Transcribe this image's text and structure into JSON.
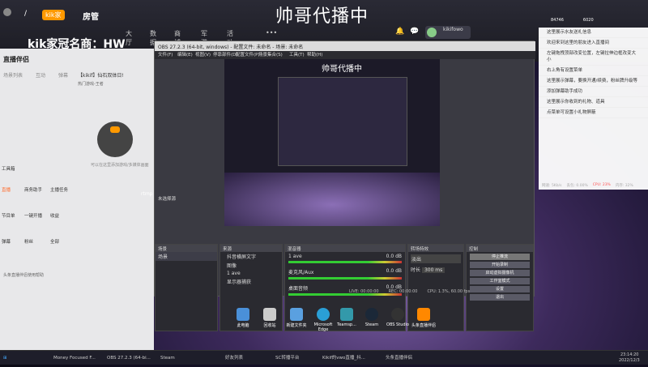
{
  "stream": {
    "title": "帅哥代播中",
    "nick_prefix": "/",
    "badge": "kik家",
    "manager": "房管",
    "overlay_name": "kik家冠名商：HW",
    "user": "kikifowo",
    "level": "4/5"
  },
  "topnav": {
    "items": [
      "大厅",
      "数据",
      "商城",
      "军港",
      "活动中心",
      "•••"
    ]
  },
  "left": {
    "brand": "直播伴侣",
    "tabs": [
      "场景列表",
      "互动",
      "弹幕"
    ],
    "date_label": "【kikif】仙石双体日!",
    "scene_label": "热门游戏-王者",
    "hint": "可以在这里添加游戏/多媒体画面",
    "tools": [
      "工具箱",
      "直播",
      "商务助手",
      "主播任务",
      "节目单",
      "一键开播",
      "收益",
      "弹幕",
      "粉丝",
      "全部",
      "更多"
    ],
    "status": "头条直播伴侣使用帮助",
    "rtmp": "rtmp"
  },
  "obs": {
    "title": "OBS 27.2.3 (64-bit, windows) - 配置文件: 未命名 - 场景: 未命名",
    "menu": [
      "文件(F)",
      "编辑(E)",
      "视图(V)",
      "停靠部件(D)",
      "配置文件(P)",
      "场景集合(S)",
      "工具(T)",
      "帮助(H)"
    ],
    "docks": {
      "scenes": "场景",
      "sources": "来源",
      "mixer": "混音器",
      "transitions": "转场特效",
      "controls": "控制"
    },
    "scene_items": [
      "场景"
    ],
    "source_items": [
      "抖音横屏文字",
      "图像",
      "1 ave",
      "显示器捕获"
    ],
    "mixer": [
      {
        "name": "1 ave",
        "db": "0.0 dB"
      },
      {
        "name": "麦克风/Aux",
        "db": "0.0 dB"
      },
      {
        "name": "桌面音频",
        "db": "0.0 dB"
      }
    ],
    "trans": {
      "type": "淡出",
      "dur_label": "时长",
      "dur": "300 ms"
    },
    "controls": [
      "停止推流",
      "开始录制",
      "启动虚拟摄像机",
      "工作室模式",
      "设置",
      "退出"
    ],
    "status": {
      "live": "LIVE: 00:00:00",
      "rec": "REC: 00:00:00",
      "cpu": "CPU: 1.3%, 60.00 fps"
    },
    "preview_label": "未选择源",
    "preview_title": "帅哥代播中"
  },
  "right": {
    "top": [
      "84746",
      "6020"
    ],
    "chat": [
      "这里展示水友送礼信息",
      "欢迎来到这里的朋友进入直播间",
      "左键拖拽顶部改变位置，左键拉伸边框改变大小",
      "右上角有设置菜单",
      "这里展示弹幕，要换开通/续费，粉丝牌升级等",
      "添加弹幕助手成功",
      "这里展示你收到的礼物、道具",
      "点菜单可设置小礼物屏蔽"
    ],
    "net": [
      "网速: 5Kb/s",
      "丢包: 0.00%",
      "CPU: 23%",
      "内存: 32%"
    ]
  },
  "desktop": [
    "此电脑",
    "回收站",
    "新建文件夹",
    "Microsoft Edge",
    "Teamsp...",
    "Steam",
    "OBS Studio",
    "头条直播伴侣"
  ],
  "taskbar": {
    "items": [
      "Money Focused F...",
      "OBS 27.2.3 (64-bi...",
      "Steam",
      "好友列表",
      "SC转播平台",
      "Kikif的vwo直播_抖...",
      "头条直播伴侣"
    ],
    "time": "23:14:20",
    "date": "2022/12/3"
  },
  "colors": {
    "accent": "#ff6a2a",
    "obs_bg": "#3a3a42",
    "live_green": "#3c3"
  }
}
